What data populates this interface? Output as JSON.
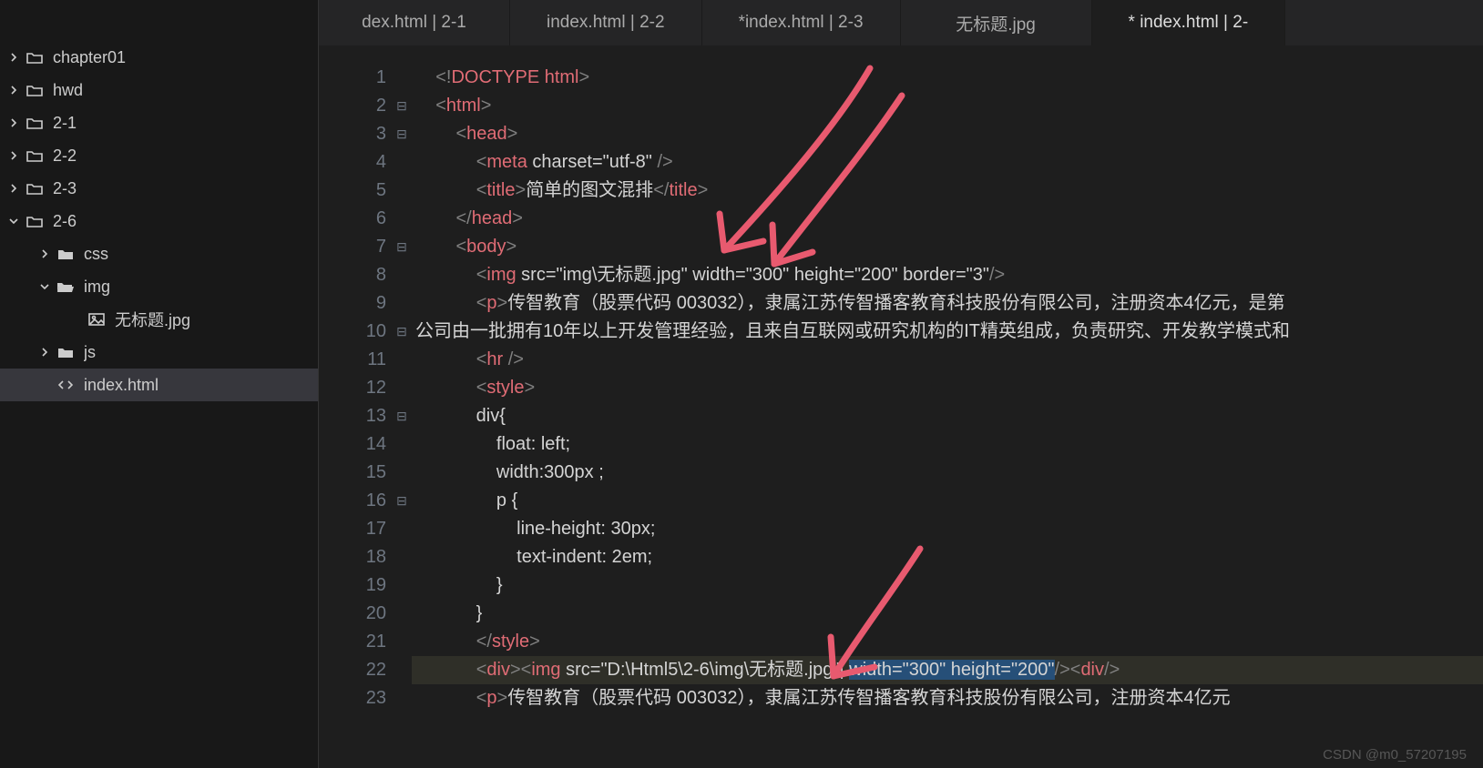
{
  "sidebar": {
    "items": [
      {
        "label": "chapter01",
        "depth": 0,
        "kind": "folder",
        "expanded": false
      },
      {
        "label": "hwd",
        "depth": 0,
        "kind": "folder",
        "expanded": false
      },
      {
        "label": "2-1",
        "depth": 0,
        "kind": "folder",
        "expanded": false
      },
      {
        "label": "2-2",
        "depth": 0,
        "kind": "folder",
        "expanded": false
      },
      {
        "label": "2-3",
        "depth": 0,
        "kind": "folder",
        "expanded": false
      },
      {
        "label": "2-6",
        "depth": 0,
        "kind": "folder",
        "expanded": true
      },
      {
        "label": "css",
        "depth": 1,
        "kind": "folder-solid",
        "expanded": false
      },
      {
        "label": "img",
        "depth": 1,
        "kind": "folder-open",
        "expanded": true
      },
      {
        "label": "无标题.jpg",
        "depth": 2,
        "kind": "image"
      },
      {
        "label": "js",
        "depth": 1,
        "kind": "folder-solid",
        "expanded": false
      },
      {
        "label": "index.html",
        "depth": 1,
        "kind": "code",
        "selected": true
      }
    ]
  },
  "tabs": [
    {
      "label": "dex.html | 2-1"
    },
    {
      "label": "index.html | 2-2"
    },
    {
      "label": "*index.html | 2-3"
    },
    {
      "label": "无标题.jpg"
    },
    {
      "label": "* index.html | 2-",
      "active": true
    }
  ],
  "code": {
    "lines": [
      {
        "n": 1,
        "fold": "",
        "tokens": [
          {
            "t": "    ",
            "c": "txt"
          },
          {
            "t": "<!",
            "c": "punc"
          },
          {
            "t": "DOCTYPE html",
            "c": "tag"
          },
          {
            "t": ">",
            "c": "punc"
          }
        ]
      },
      {
        "n": 2,
        "fold": "⊟",
        "tokens": [
          {
            "t": "    ",
            "c": "txt"
          },
          {
            "t": "<",
            "c": "punc"
          },
          {
            "t": "html",
            "c": "tag"
          },
          {
            "t": ">",
            "c": "punc"
          }
        ]
      },
      {
        "n": 3,
        "fold": "⊟",
        "tokens": [
          {
            "t": "        ",
            "c": "txt"
          },
          {
            "t": "<",
            "c": "punc"
          },
          {
            "t": "head",
            "c": "tag"
          },
          {
            "t": ">",
            "c": "punc"
          }
        ]
      },
      {
        "n": 4,
        "fold": "",
        "tokens": [
          {
            "t": "            ",
            "c": "txt"
          },
          {
            "t": "<",
            "c": "punc"
          },
          {
            "t": "meta ",
            "c": "tag"
          },
          {
            "t": "charset=",
            "c": "attrn"
          },
          {
            "t": "\"utf-8\"",
            "c": "attrv"
          },
          {
            "t": " />",
            "c": "punc"
          }
        ]
      },
      {
        "n": 5,
        "fold": "",
        "tokens": [
          {
            "t": "            ",
            "c": "txt"
          },
          {
            "t": "<",
            "c": "punc"
          },
          {
            "t": "title",
            "c": "tag"
          },
          {
            "t": ">",
            "c": "punc"
          },
          {
            "t": "简单的图文混排",
            "c": "txt"
          },
          {
            "t": "</",
            "c": "punc"
          },
          {
            "t": "title",
            "c": "tag"
          },
          {
            "t": ">",
            "c": "punc"
          }
        ]
      },
      {
        "n": 6,
        "fold": "",
        "tokens": [
          {
            "t": "        ",
            "c": "txt"
          },
          {
            "t": "</",
            "c": "punc"
          },
          {
            "t": "head",
            "c": "tag"
          },
          {
            "t": ">",
            "c": "punc"
          }
        ]
      },
      {
        "n": 7,
        "fold": "⊟",
        "tokens": [
          {
            "t": "        ",
            "c": "txt"
          },
          {
            "t": "<",
            "c": "punc"
          },
          {
            "t": "body",
            "c": "tag"
          },
          {
            "t": ">",
            "c": "punc"
          }
        ]
      },
      {
        "n": 8,
        "fold": "",
        "tokens": [
          {
            "t": "            ",
            "c": "txt"
          },
          {
            "t": "<",
            "c": "punc"
          },
          {
            "t": "img ",
            "c": "tag"
          },
          {
            "t": "src=",
            "c": "attrn"
          },
          {
            "t": "\"img\\无标题.jpg\"",
            "c": "attrv"
          },
          {
            "t": " width=",
            "c": "attrn"
          },
          {
            "t": "\"300\"",
            "c": "attrv"
          },
          {
            "t": " height=",
            "c": "attrn"
          },
          {
            "t": "\"200\"",
            "c": "attrv"
          },
          {
            "t": " border=",
            "c": "attrn"
          },
          {
            "t": "\"3\"",
            "c": "attrv"
          },
          {
            "t": "/>",
            "c": "punc"
          }
        ]
      },
      {
        "n": 9,
        "fold": "",
        "tokens": [
          {
            "t": "            ",
            "c": "txt"
          },
          {
            "t": "<",
            "c": "punc"
          },
          {
            "t": "p",
            "c": "tag"
          },
          {
            "t": ">",
            "c": "punc"
          },
          {
            "t": "传智教育（股票代码 003032），隶属江苏传智播客教育科技股份有限公司，注册资本4亿元，是第",
            "c": "txt"
          }
        ]
      },
      {
        "n": 10,
        "fold": "⊟",
        "tokens": [
          {
            "t": "公司由一批拥有10年以上开发管理经验，且来自互联网或研究机构的IT精英组成，负责研究、开发教学模式和",
            "c": "txt"
          }
        ]
      },
      {
        "n": 11,
        "fold": "",
        "tokens": [
          {
            "t": "            ",
            "c": "txt"
          },
          {
            "t": "<",
            "c": "punc"
          },
          {
            "t": "hr ",
            "c": "tag"
          },
          {
            "t": "/>",
            "c": "punc"
          }
        ]
      },
      {
        "n": 12,
        "fold": "",
        "tokens": [
          {
            "t": "            ",
            "c": "txt"
          },
          {
            "t": "<",
            "c": "punc"
          },
          {
            "t": "style",
            "c": "tag"
          },
          {
            "t": ">",
            "c": "punc"
          }
        ]
      },
      {
        "n": 13,
        "fold": "⊟",
        "tokens": [
          {
            "t": "            div{",
            "c": "txt"
          }
        ]
      },
      {
        "n": 14,
        "fold": "",
        "tokens": [
          {
            "t": "                float: left;",
            "c": "txt"
          }
        ]
      },
      {
        "n": 15,
        "fold": "",
        "tokens": [
          {
            "t": "                width:300px ;",
            "c": "txt"
          }
        ]
      },
      {
        "n": 16,
        "fold": "⊟",
        "tokens": [
          {
            "t": "                p {",
            "c": "txt"
          }
        ]
      },
      {
        "n": 17,
        "fold": "",
        "tokens": [
          {
            "t": "                    line-height: 30px;",
            "c": "txt"
          }
        ]
      },
      {
        "n": 18,
        "fold": "",
        "tokens": [
          {
            "t": "                    text-indent: 2em;",
            "c": "txt"
          }
        ]
      },
      {
        "n": 19,
        "fold": "",
        "tokens": [
          {
            "t": "                }",
            "c": "txt"
          }
        ]
      },
      {
        "n": 20,
        "fold": "",
        "tokens": [
          {
            "t": "            }",
            "c": "txt"
          }
        ]
      },
      {
        "n": 21,
        "fold": "",
        "tokens": [
          {
            "t": "            ",
            "c": "txt"
          },
          {
            "t": "</",
            "c": "punc"
          },
          {
            "t": "style",
            "c": "tag"
          },
          {
            "t": ">",
            "c": "punc"
          }
        ]
      },
      {
        "n": 22,
        "fold": "",
        "hl": true,
        "tokens": [
          {
            "t": "            ",
            "c": "txt"
          },
          {
            "t": "<",
            "c": "punc"
          },
          {
            "t": "div",
            "c": "tag"
          },
          {
            "t": "><",
            "c": "punc"
          },
          {
            "t": "img ",
            "c": "tag"
          },
          {
            "t": "src=",
            "c": "attrn"
          },
          {
            "t": "\"D:\\Html5\\2-6\\img\\无标题.jpg\"",
            "c": "attrv"
          },
          {
            "t": "|",
            "c": "cursor-caret"
          },
          {
            "t": " ",
            "c": "txt"
          },
          {
            "t": "width=",
            "c": "attrn",
            "bg": "sel"
          },
          {
            "t": "\"300\"",
            "c": "attrv",
            "bg": "sel"
          },
          {
            "t": " ",
            "c": "txt",
            "bg": "sel"
          },
          {
            "t": "height=",
            "c": "attrn",
            "bg": "sel"
          },
          {
            "t": "\"200\"",
            "c": "attrv",
            "bg": "sel"
          },
          {
            "t": "/><",
            "c": "punc"
          },
          {
            "t": "div",
            "c": "tag"
          },
          {
            "t": "/>",
            "c": "punc"
          }
        ]
      },
      {
        "n": 23,
        "fold": "",
        "tokens": [
          {
            "t": "            ",
            "c": "txt"
          },
          {
            "t": "<",
            "c": "punc"
          },
          {
            "t": "p",
            "c": "tag"
          },
          {
            "t": ">",
            "c": "punc"
          },
          {
            "t": "传智教育（股票代码 003032），隶属江苏传智播客教育科技股份有限公司，注册资本4亿元",
            "c": "txt"
          }
        ]
      }
    ]
  },
  "watermark": "CSDN @m0_57207195"
}
